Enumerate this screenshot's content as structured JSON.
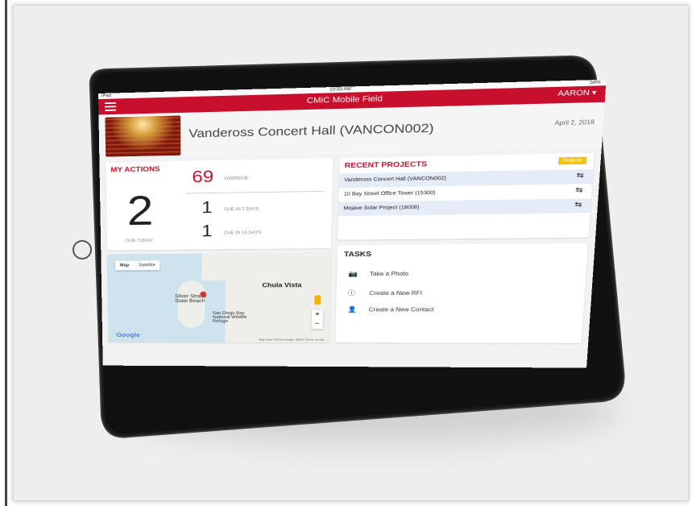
{
  "status": {
    "carrier": "iPad",
    "time": "10:53 AM",
    "battery": "58%"
  },
  "app": {
    "title": "CMiC Mobile Field",
    "user": "AARON ▾"
  },
  "project": {
    "title": "Vandeross Concert Hall (VANCON002)",
    "date": "April 2, 2018"
  },
  "actions": {
    "title": "MY ACTIONS",
    "due_today_count": "2",
    "due_today_label": "DUE TODAY",
    "overdue_count": "69",
    "overdue_label": "OVERDUE",
    "due7_count": "1",
    "due7_label": "DUE IN 7 DAYS",
    "due14_count": "1",
    "due14_label": "DUE IN 14 DAYS"
  },
  "recent": {
    "title": "RECENT PROJECTS",
    "badge": "Projects",
    "items": [
      {
        "label": "Vandeross Concert Hall (VANCON002)"
      },
      {
        "label": "10 Bay Street Office Tower (15300)"
      },
      {
        "label": "Mojave Solar Project (18008)"
      }
    ]
  },
  "map": {
    "tab_map": "Map",
    "tab_satellite": "Satellite",
    "city": "Chula Vista",
    "beach": "Silver Strand State Beach",
    "refuge": "San Diego Bay National Wildlife Refuge",
    "google": "Google",
    "footer": "Map data ©2018 Google, INEGI   Terms of Use"
  },
  "tasks": {
    "title": "TASKS",
    "items": [
      {
        "icon": "camera-icon",
        "label": "Take a Photo"
      },
      {
        "icon": "info-icon",
        "label": "Create a New RFI"
      },
      {
        "icon": "add-contact-icon",
        "label": "Create a New Contact"
      }
    ]
  },
  "colors": {
    "brand_red": "#c8102e",
    "badge_yellow": "#f2c40f",
    "row_blue": "#e6ecf7"
  }
}
